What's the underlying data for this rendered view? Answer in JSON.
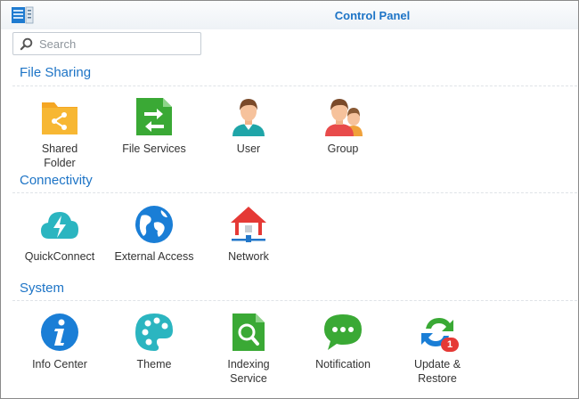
{
  "window": {
    "title": "Control Panel"
  },
  "search": {
    "placeholder": "Search",
    "value": ""
  },
  "sections": [
    {
      "title": "File Sharing",
      "items": [
        {
          "label": "Shared\nFolder",
          "icon": "shared-folder-icon"
        },
        {
          "label": "File Services",
          "icon": "file-services-icon"
        },
        {
          "label": "User",
          "icon": "user-icon"
        },
        {
          "label": "Group",
          "icon": "group-icon"
        }
      ]
    },
    {
      "title": "Connectivity",
      "items": [
        {
          "label": "QuickConnect",
          "icon": "quickconnect-icon"
        },
        {
          "label": "External Access",
          "icon": "external-access-icon"
        },
        {
          "label": "Network",
          "icon": "network-icon"
        }
      ]
    },
    {
      "title": "System",
      "items": [
        {
          "label": "Info Center",
          "icon": "info-icon"
        },
        {
          "label": "Theme",
          "icon": "palette-icon"
        },
        {
          "label": "Indexing\nService",
          "icon": "indexing-service-icon"
        },
        {
          "label": "Notification",
          "icon": "chat-bubble-icon"
        },
        {
          "label": "Update &\nRestore",
          "icon": "update-restore-icon",
          "badge": "1"
        }
      ]
    }
  ],
  "colors": {
    "accent": "#1d74c6",
    "folder": "#f5a623",
    "green": "#3aa935",
    "blue": "#1a7ed6",
    "teal": "#2bb5c0",
    "red": "#e53935"
  }
}
